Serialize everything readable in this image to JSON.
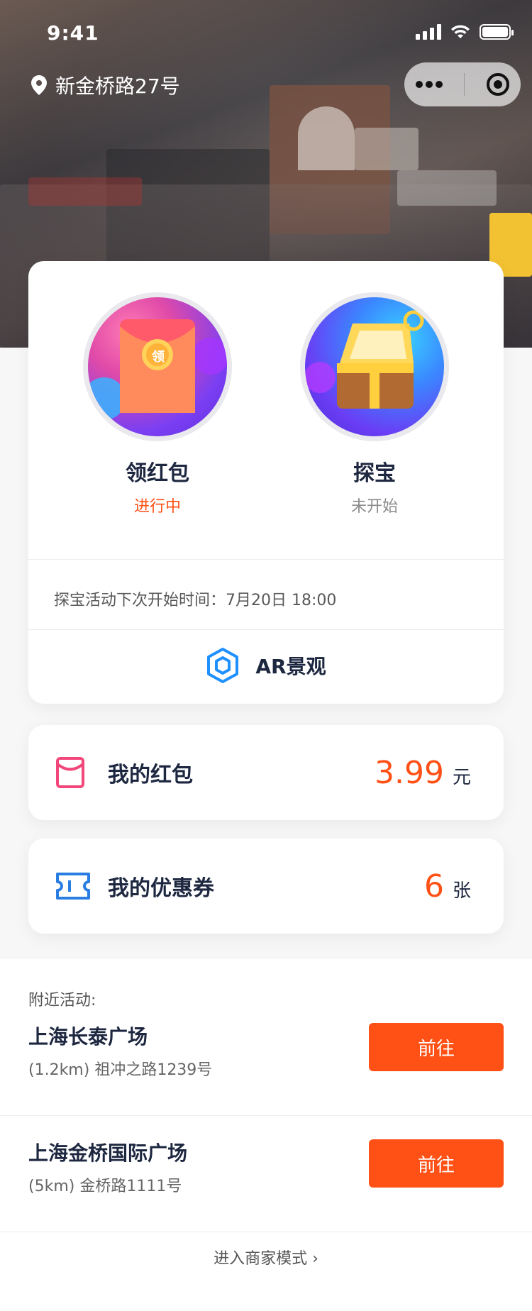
{
  "status_bar": {
    "time": "9:41"
  },
  "location": {
    "name": "新金桥路27号"
  },
  "activities": {
    "hongbao": {
      "title": "领红包",
      "status": "进行中",
      "badge": "领",
      "status_color": "#ff5015"
    },
    "treasure": {
      "title": "探宝",
      "status": "未开始",
      "status_color": "#8a8a8a"
    }
  },
  "next_time_text": "探宝活动下次开始时间：7月20日 18:00",
  "ar": {
    "label": "AR景观"
  },
  "my_hongbao": {
    "label": "我的红包",
    "value": "3.99",
    "unit": "元"
  },
  "my_coupon": {
    "label": "我的优惠券",
    "value": "6",
    "unit": "张"
  },
  "nearby": {
    "title": "附近活动:",
    "places": [
      {
        "name": "上海长泰广场",
        "address": "(1.2km) 祖冲之路1239号",
        "button": "前往"
      },
      {
        "name": "上海金桥国际广场",
        "address": "(5km) 金桥路1111号",
        "button": "前往"
      }
    ]
  },
  "merchant_link": {
    "label": "进入商家模式 ›"
  },
  "colors": {
    "accent": "#ff5015",
    "title": "#1d2740",
    "ar_icon": "#1e90ff",
    "coupon_icon": "#2a7de1",
    "hongbao_icon": "#f1477a"
  }
}
